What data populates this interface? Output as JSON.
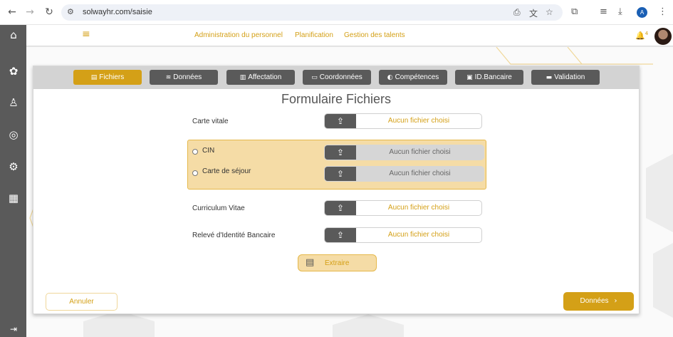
{
  "browser": {
    "url": "solwayhr.com/saisie",
    "profile_initial": "A"
  },
  "header": {
    "menu": [
      "Administration du personnel",
      "Planification",
      "Gestion des talents"
    ],
    "notification_count": "4"
  },
  "steps": [
    {
      "label": "Fichiers",
      "active": true
    },
    {
      "label": "Données"
    },
    {
      "label": "Affectation"
    },
    {
      "label": "Coordonnées"
    },
    {
      "label": "Compétences"
    },
    {
      "label": "ID.Bancaire"
    },
    {
      "label": "Validation"
    }
  ],
  "form": {
    "title": "Formulaire Fichiers",
    "no_file": "Aucun fichier choisi",
    "fields": {
      "carte_vitale": "Carte vitale",
      "cin": "CIN",
      "carte_sejour": "Carte de séjour",
      "cv": "Curriculum Vitae",
      "rib": "Relevé d'Identité Bancaire"
    },
    "extract_label": "Extraire"
  },
  "actions": {
    "cancel": "Annuler",
    "next": "Données"
  },
  "colors": {
    "accent": "#d4a017",
    "sidebar": "#5a5a5a",
    "group_bg": "#f5dca6"
  }
}
